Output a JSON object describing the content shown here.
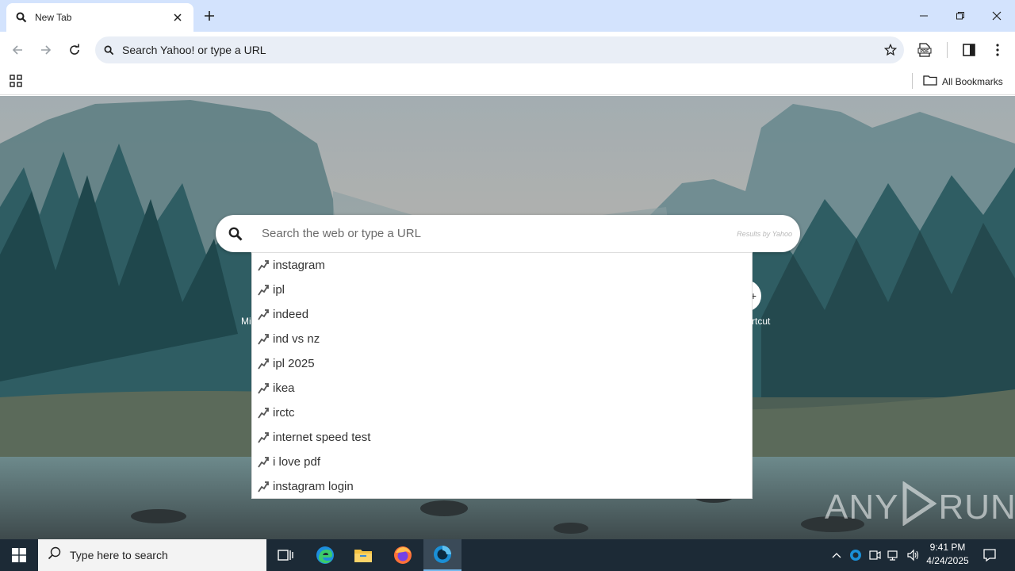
{
  "tab": {
    "title": "New Tab"
  },
  "omnibox": {
    "text": "Search Yahoo! or type a URL"
  },
  "bookmarks": {
    "all_bookmarks": "All Bookmarks"
  },
  "search": {
    "placeholder": "Search the web or type a URL",
    "results_by": "Results by Yahoo"
  },
  "shortcuts": {
    "left_partial": "Mi",
    "right_partial": "rtcut"
  },
  "suggestions": [
    "instagram",
    "ipl",
    "indeed",
    "ind vs nz",
    "ipl 2025",
    "ikea",
    "irctc",
    "internet speed test",
    "i love pdf",
    "instagram login"
  ],
  "watermark": {
    "left": "ANY",
    "right": "RUN"
  },
  "taskbar": {
    "search_placeholder": "Type here to search",
    "time": "9:41 PM",
    "date": "4/24/2025"
  },
  "colors": {
    "tabstrip": "#d3e3fd",
    "omnibox": "#e9eef6",
    "taskbar": "#1c2a36",
    "active_app_underline": "#76b9ed"
  }
}
